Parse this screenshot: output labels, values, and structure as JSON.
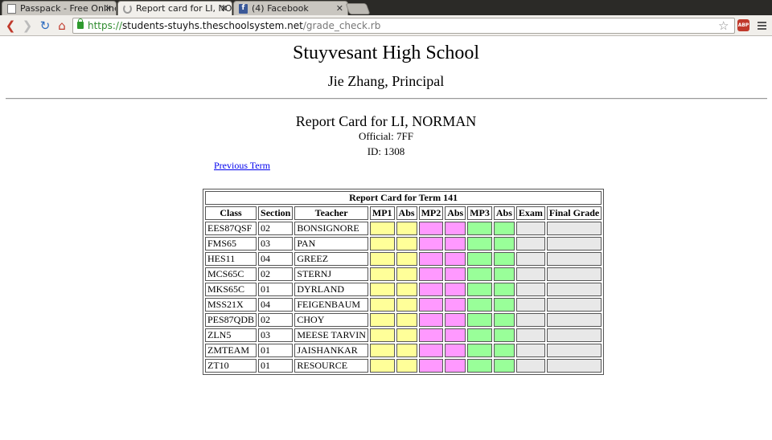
{
  "browser": {
    "tabs": [
      {
        "title": "Passpack - Free Online",
        "icon": "document-icon"
      },
      {
        "title": "Report card for LI, NO",
        "icon": "loading-icon"
      },
      {
        "title": "(4) Facebook",
        "icon": "facebook-icon"
      }
    ],
    "url": {
      "scheme": "https://",
      "host": "students-stuyhs.theschoolsystem.net",
      "path": "/grade_check.rb"
    }
  },
  "page": {
    "school_name": "Stuyvesant High School",
    "principal": "Jie Zhang, Principal",
    "report_title": "Report Card for LI, NORMAN",
    "official": "Official: 7FF",
    "id": "ID: 1308",
    "previous_term_link": "Previous Term"
  },
  "table": {
    "caption": "Report Card for Term 141",
    "headers": [
      "Class",
      "Section",
      "Teacher",
      "MP1",
      "Abs",
      "MP2",
      "Abs",
      "MP3",
      "Abs",
      "Exam",
      "Final Grade"
    ],
    "rows": [
      {
        "class": "EES87QSF",
        "section": "02",
        "teacher": "BONSIGNORE"
      },
      {
        "class": "FMS65",
        "section": "03",
        "teacher": "PAN"
      },
      {
        "class": "HES11",
        "section": "04",
        "teacher": "GREEZ"
      },
      {
        "class": "MCS65C",
        "section": "02",
        "teacher": "STERNJ"
      },
      {
        "class": "MKS65C",
        "section": "01",
        "teacher": "DYRLAND"
      },
      {
        "class": "MSS21X",
        "section": "04",
        "teacher": "FEIGENBAUM"
      },
      {
        "class": "PES87QDB",
        "section": "02",
        "teacher": "CHOY"
      },
      {
        "class": "ZLN5",
        "section": "03",
        "teacher": "MEESE TARVIN"
      },
      {
        "class": "ZMTEAM",
        "section": "01",
        "teacher": "JAISHANKAR"
      },
      {
        "class": "ZT10",
        "section": "01",
        "teacher": "RESOURCE"
      }
    ],
    "colors": {
      "mp1": "#ffff99",
      "mp2": "#ff99ff",
      "mp3": "#99ff99",
      "exam": "#e8e8e8"
    }
  }
}
